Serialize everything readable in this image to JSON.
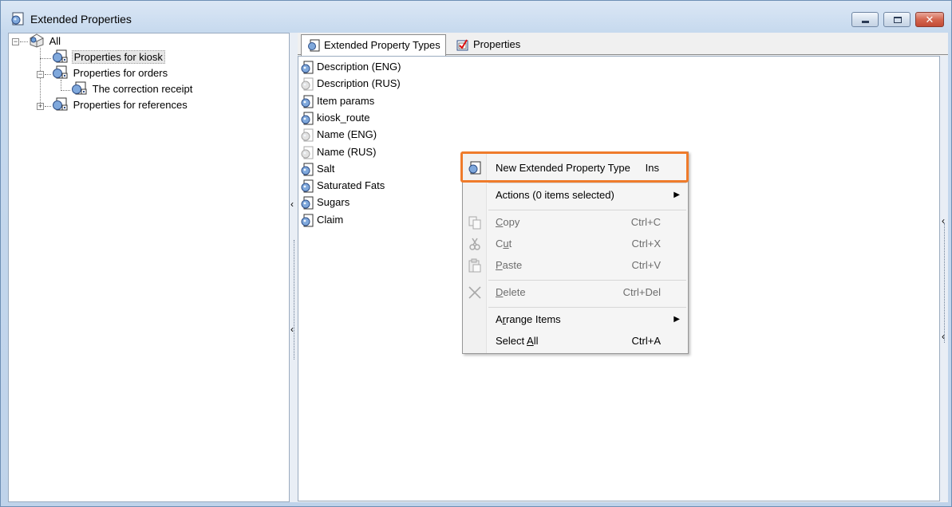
{
  "window": {
    "title": "Extended Properties",
    "icon": "extended-property-icon"
  },
  "tree": {
    "root": {
      "label": "All",
      "icon": "all-items-icon"
    },
    "items": [
      {
        "label": "Properties for kiosk",
        "icon": "property-folder-icon",
        "selected": true
      },
      {
        "label": "Properties for orders",
        "icon": "property-folder-icon",
        "expanded": true
      },
      {
        "label": "The correction receipt",
        "icon": "property-folder-icon"
      },
      {
        "label": "Properties for references",
        "icon": "property-folder-icon",
        "expanded": false
      }
    ]
  },
  "tabs": [
    {
      "label": "Extended Property Types",
      "icon": "extended-property-icon",
      "active": true
    },
    {
      "label": "Properties",
      "icon": "properties-check-icon",
      "active": false
    }
  ],
  "list": {
    "items": [
      {
        "label": "Description (ENG)",
        "enabled": true
      },
      {
        "label": "Description (RUS)",
        "enabled": false
      },
      {
        "label": "Item params",
        "enabled": true
      },
      {
        "label": "kiosk_route",
        "enabled": true
      },
      {
        "label": "Name (ENG)",
        "enabled": false
      },
      {
        "label": "Name (RUS)",
        "enabled": false
      },
      {
        "label": "Salt",
        "enabled": true
      },
      {
        "label": "Saturated Fats",
        "enabled": true
      },
      {
        "label": "Sugars",
        "enabled": true
      },
      {
        "label": "Claim",
        "enabled": true
      }
    ]
  },
  "context_menu": {
    "new_type": {
      "label": "New Extended Property Type",
      "shortcut": "Ins"
    },
    "actions": {
      "label": "Actions (0 items selected)"
    },
    "copy": {
      "label": "Copy",
      "shortcut": "Ctrl+C"
    },
    "cut": {
      "label": "Cut",
      "shortcut": "Ctrl+X"
    },
    "paste": {
      "label": "Paste",
      "shortcut": "Ctrl+V"
    },
    "delete": {
      "label": "Delete",
      "shortcut": "Ctrl+Del"
    },
    "arrange": {
      "label": "Arrange Items"
    },
    "select_all": {
      "label": "Select All",
      "shortcut": "Ctrl+A"
    }
  },
  "colors": {
    "highlight_border": "#ef7b2b",
    "title_bar": "#c6d9ee"
  }
}
